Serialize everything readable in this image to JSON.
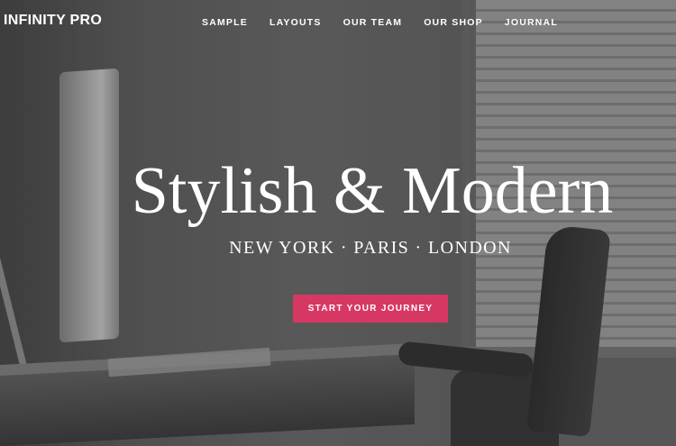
{
  "site": {
    "title": "INFINITY PRO"
  },
  "nav": {
    "items": [
      {
        "label": "SAMPLE"
      },
      {
        "label": "LAYOUTS"
      },
      {
        "label": "OUR TEAM"
      },
      {
        "label": "OUR SHOP"
      },
      {
        "label": "JOURNAL"
      }
    ]
  },
  "hero": {
    "headline": "Stylish & Modern",
    "subheadline": "NEW YORK · PARIS · LONDON",
    "cta_label": "START YOUR JOURNEY"
  },
  "colors": {
    "accent": "#d73863",
    "text": "#ffffff"
  }
}
